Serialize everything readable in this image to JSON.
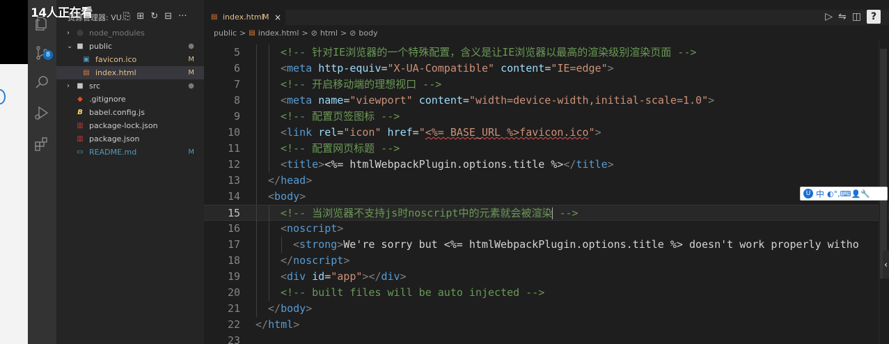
{
  "overlay": {
    "viewers": "14人正在看"
  },
  "activity_bar": {
    "scm_badge": "8"
  },
  "sidebar": {
    "title": "资源管理器: VU...",
    "items": [
      {
        "label": "node_modules",
        "type": "folder",
        "expanded": false,
        "status": ""
      },
      {
        "label": "public",
        "type": "folder",
        "expanded": true,
        "status": "●"
      },
      {
        "label": "favicon.ico",
        "type": "file",
        "status": "M"
      },
      {
        "label": "index.html",
        "type": "file",
        "status": "M"
      },
      {
        "label": "src",
        "type": "folder",
        "expanded": false,
        "status": "●"
      },
      {
        "label": ".gitignore",
        "type": "file",
        "status": ""
      },
      {
        "label": "babel.config.js",
        "type": "file",
        "status": ""
      },
      {
        "label": "package-lock.json",
        "type": "file",
        "status": ""
      },
      {
        "label": "package.json",
        "type": "file",
        "status": ""
      },
      {
        "label": "README.md",
        "type": "file",
        "status": "M"
      }
    ]
  },
  "editor": {
    "tab": {
      "name": "index.html",
      "status": "M",
      "close": "×"
    },
    "breadcrumb": [
      "public",
      ">",
      "index.html",
      ">",
      "html",
      ">",
      "body"
    ],
    "current_line": 15,
    "lines": [
      {
        "n": "5",
        "text": "<!-- 针对IE浏览器的一个特殊配置，含义是让IE浏览器以最高的渲染级别渲染页面 -->"
      },
      {
        "n": "6",
        "text": "<meta http-equiv=\"X-UA-Compatible\" content=\"IE=edge\">"
      },
      {
        "n": "7",
        "text": "<!-- 开启移动端的理想视口 -->"
      },
      {
        "n": "8",
        "text": "<meta name=\"viewport\" content=\"width=device-width,initial-scale=1.0\">"
      },
      {
        "n": "9",
        "text": "<!-- 配置页签图标 -->"
      },
      {
        "n": "10",
        "text": "<link rel=\"icon\" href=\"<%= BASE_URL %>favicon.ico\">"
      },
      {
        "n": "11",
        "text": "<!-- 配置网页标题 -->"
      },
      {
        "n": "12",
        "text": "<title><%= htmlWebpackPlugin.options.title %></title>"
      },
      {
        "n": "13",
        "text": "</head>"
      },
      {
        "n": "14",
        "text": "<body>"
      },
      {
        "n": "15",
        "text": "<!-- 当浏览器不支持js时noscript中的元素就会被渲染 -->"
      },
      {
        "n": "16",
        "text": "<noscript>"
      },
      {
        "n": "17",
        "text": "<strong>We're sorry but <%= htmlWebpackPlugin.options.title %> doesn't work properly witho"
      },
      {
        "n": "18",
        "text": "</noscript>"
      },
      {
        "n": "19",
        "text": "<div id=\"app\"></div>"
      },
      {
        "n": "20",
        "text": "<!-- built files will be auto injected -->"
      },
      {
        "n": "21",
        "text": "</body>"
      },
      {
        "n": "22",
        "text": "</html>"
      },
      {
        "n": "23",
        "text": ""
      }
    ]
  },
  "ime": {
    "label": "中",
    "items": "◐°,⌨👤🔧"
  },
  "colors": {
    "comment": "#6a9955",
    "tag": "#569cd6",
    "attr": "#9cdcfe",
    "string": "#ce9178",
    "modified": "#e2c08d"
  }
}
